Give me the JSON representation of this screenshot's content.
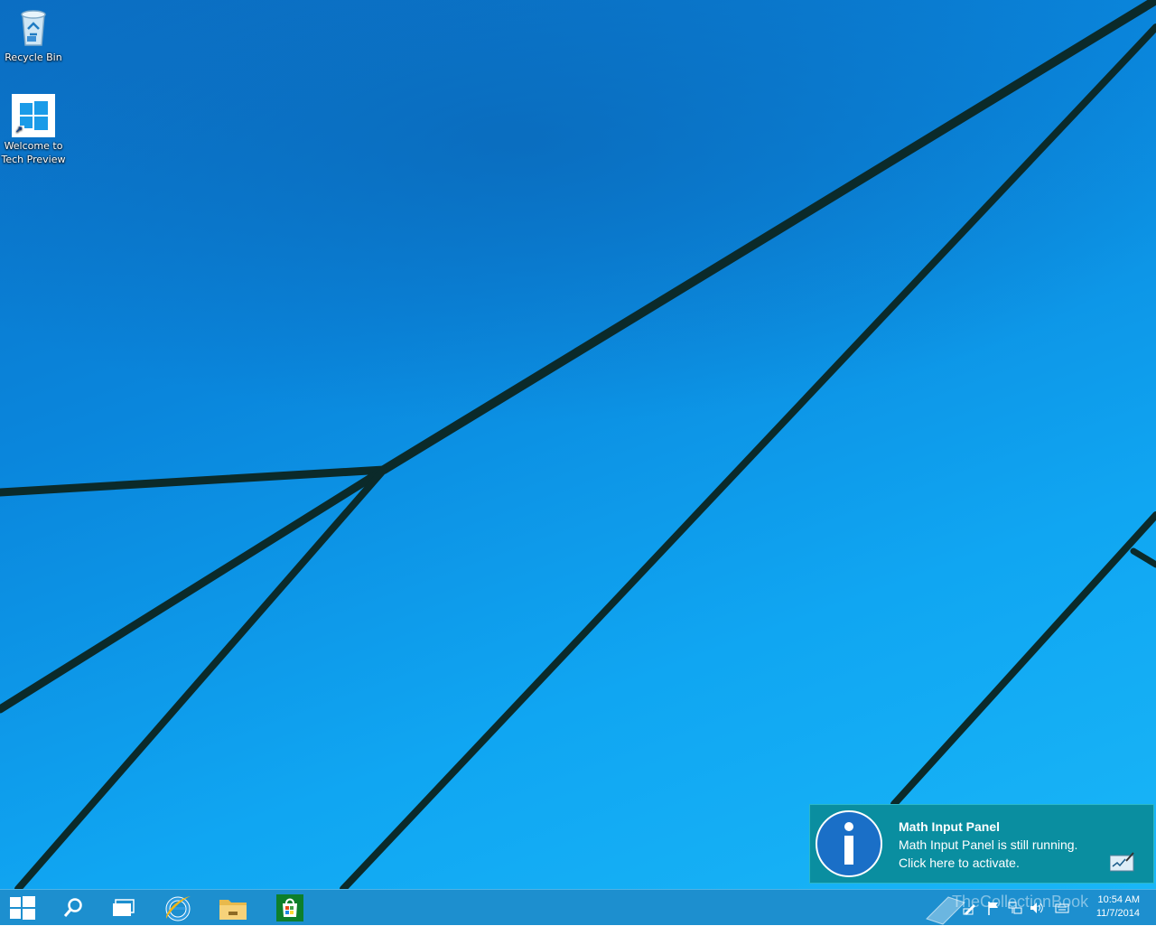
{
  "desktop": {
    "icons": [
      {
        "label": "Recycle Bin",
        "icon": "recycle-bin-icon"
      },
      {
        "label_line1": "Welcome to",
        "label_line2": "Tech Preview",
        "icon": "windows-logo-icon"
      }
    ]
  },
  "toast": {
    "title": "Math Input Panel",
    "line1": "Math Input Panel is still running.",
    "line2": "Click here to activate.",
    "icon": "info-icon",
    "app_icon": "math-input-panel-icon",
    "background": "#0a8ea0"
  },
  "taskbar": {
    "buttons": [
      {
        "name": "start",
        "icon": "windows-logo-icon"
      },
      {
        "name": "search",
        "icon": "search-icon"
      },
      {
        "name": "task-view",
        "icon": "task-view-icon"
      },
      {
        "name": "internet-explorer",
        "icon": "ie-icon"
      },
      {
        "name": "file-explorer",
        "icon": "folder-icon"
      },
      {
        "name": "store",
        "icon": "store-icon"
      }
    ],
    "clock": {
      "time": "10:54 AM",
      "date": "11/7/2014"
    },
    "watermark": "TheCollectionBook",
    "tray_icons": [
      "pen-icon",
      "flag-icon",
      "network-icon",
      "volume-icon",
      "keyboard-icon"
    ],
    "accent": "#1d8fcf"
  }
}
